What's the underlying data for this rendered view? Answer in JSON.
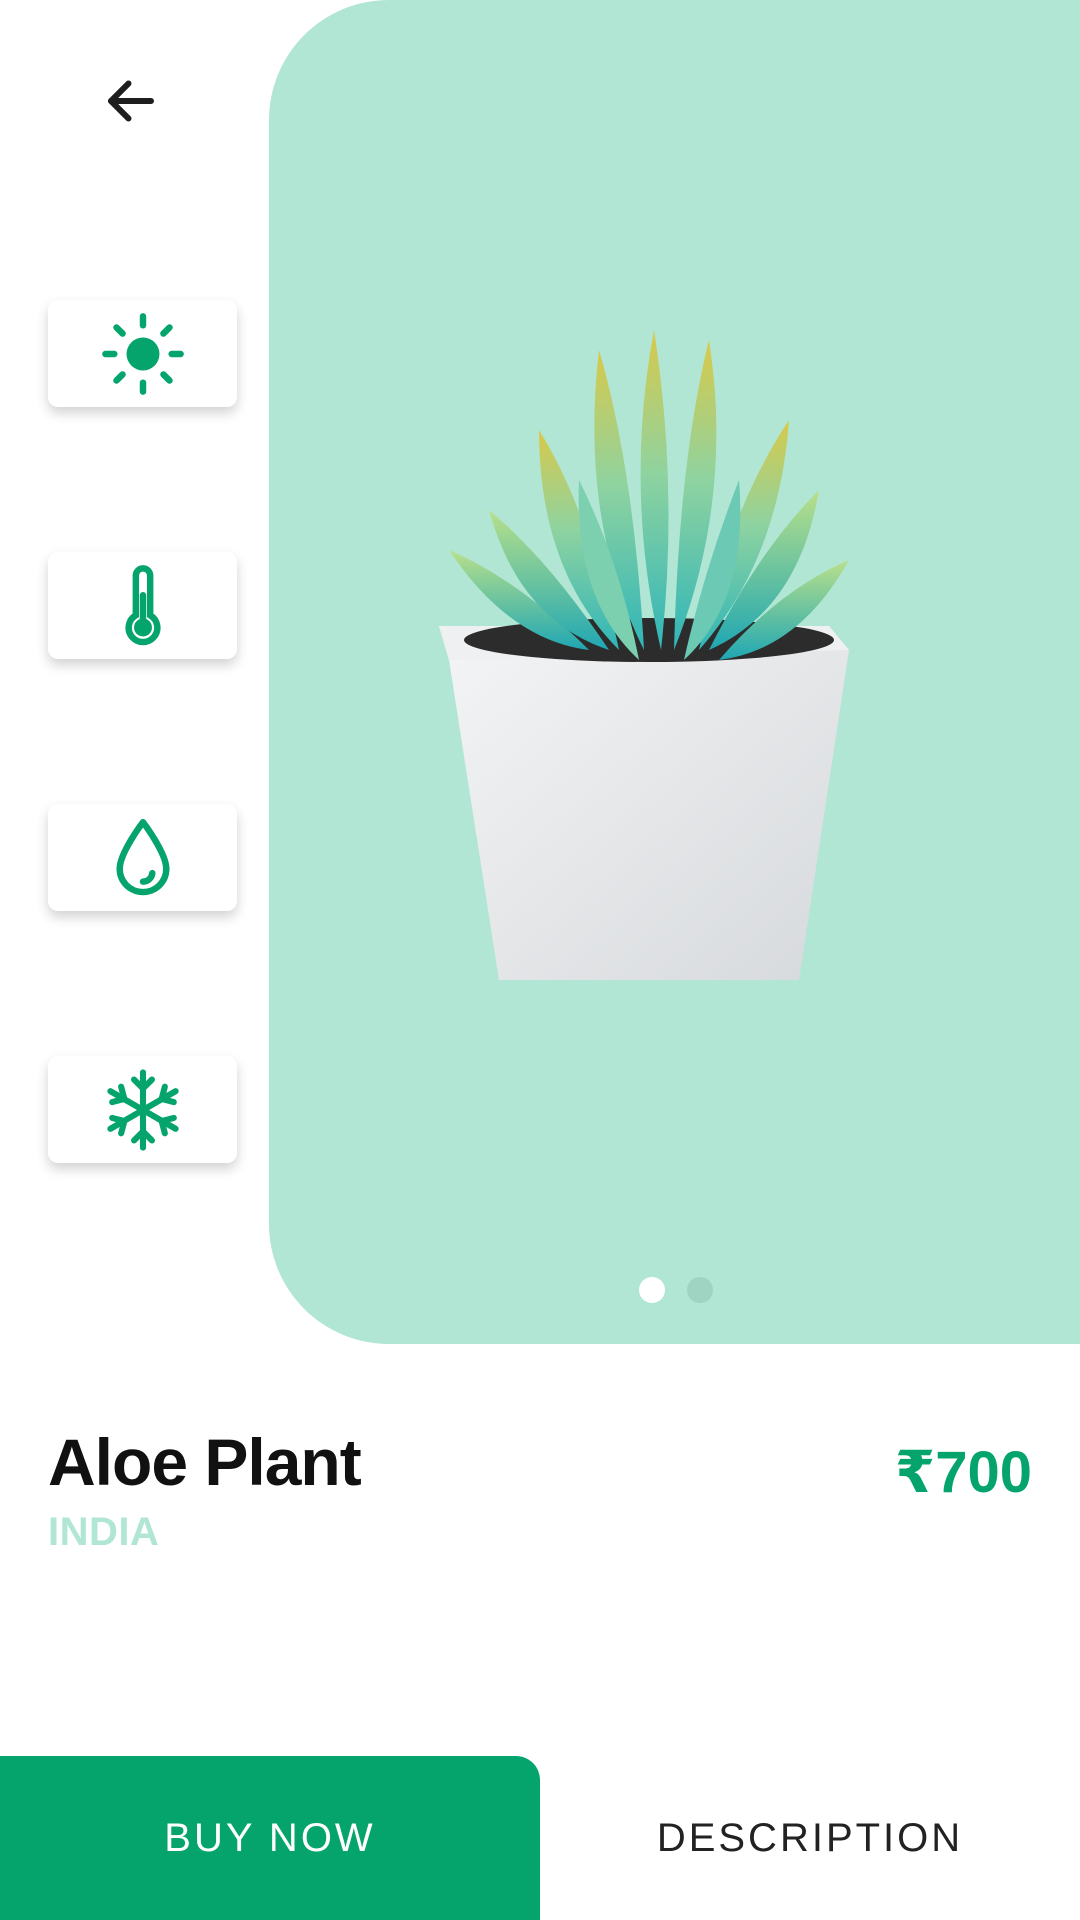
{
  "colors": {
    "accent": "#05a46c",
    "hero_background": "#b2e6d4",
    "dot_active": "#ffffff",
    "dot_inactive": "#9fd3c2"
  },
  "header": {
    "back_icon": "arrow-left-icon"
  },
  "features": [
    {
      "icon": "sun-icon"
    },
    {
      "icon": "thermometer-icon"
    },
    {
      "icon": "water-drop-icon"
    },
    {
      "icon": "snowflake-icon"
    }
  ],
  "carousel": {
    "total_pages": 2,
    "active_page": 1
  },
  "product": {
    "name": "Aloe Plant",
    "origin": "INDIA",
    "price": "₹700"
  },
  "actions": {
    "buy_label": "BUY NOW",
    "description_label": "DESCRIPTION"
  }
}
